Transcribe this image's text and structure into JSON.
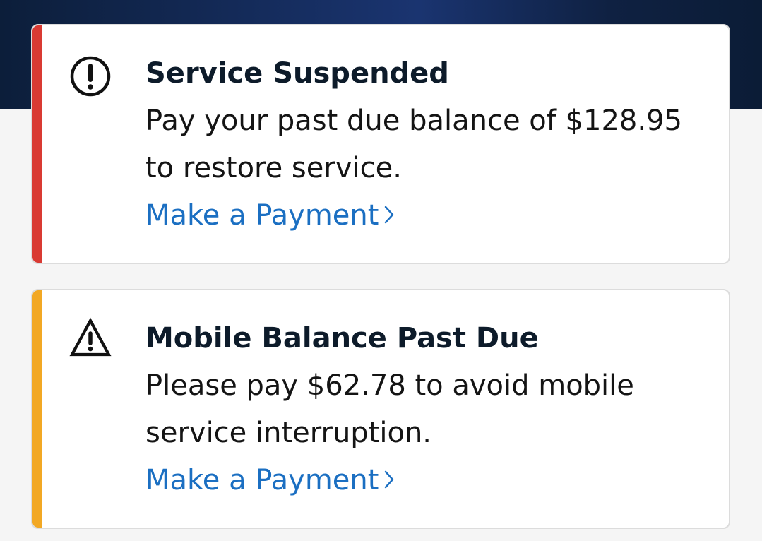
{
  "colors": {
    "header_background": "#0c1e3a",
    "page_background": "#f5f5f5",
    "error_accent": "#d93a33",
    "warning_accent": "#f2a824",
    "link": "#1b6fc2",
    "title_text": "#0d1b2a"
  },
  "alerts": [
    {
      "severity": "error",
      "icon": "exclamation-circle-icon",
      "title": "Service Suspended",
      "message": "Pay your past due balance of $128.95 to restore service.",
      "action_label": "Make a Payment",
      "action_icon": "chevron-right-icon"
    },
    {
      "severity": "warning",
      "icon": "warning-triangle-icon",
      "title": "Mobile Balance Past Due",
      "message": "Please pay $62.78 to avoid mobile service interruption.",
      "action_label": "Make a Payment",
      "action_icon": "chevron-right-icon"
    }
  ]
}
